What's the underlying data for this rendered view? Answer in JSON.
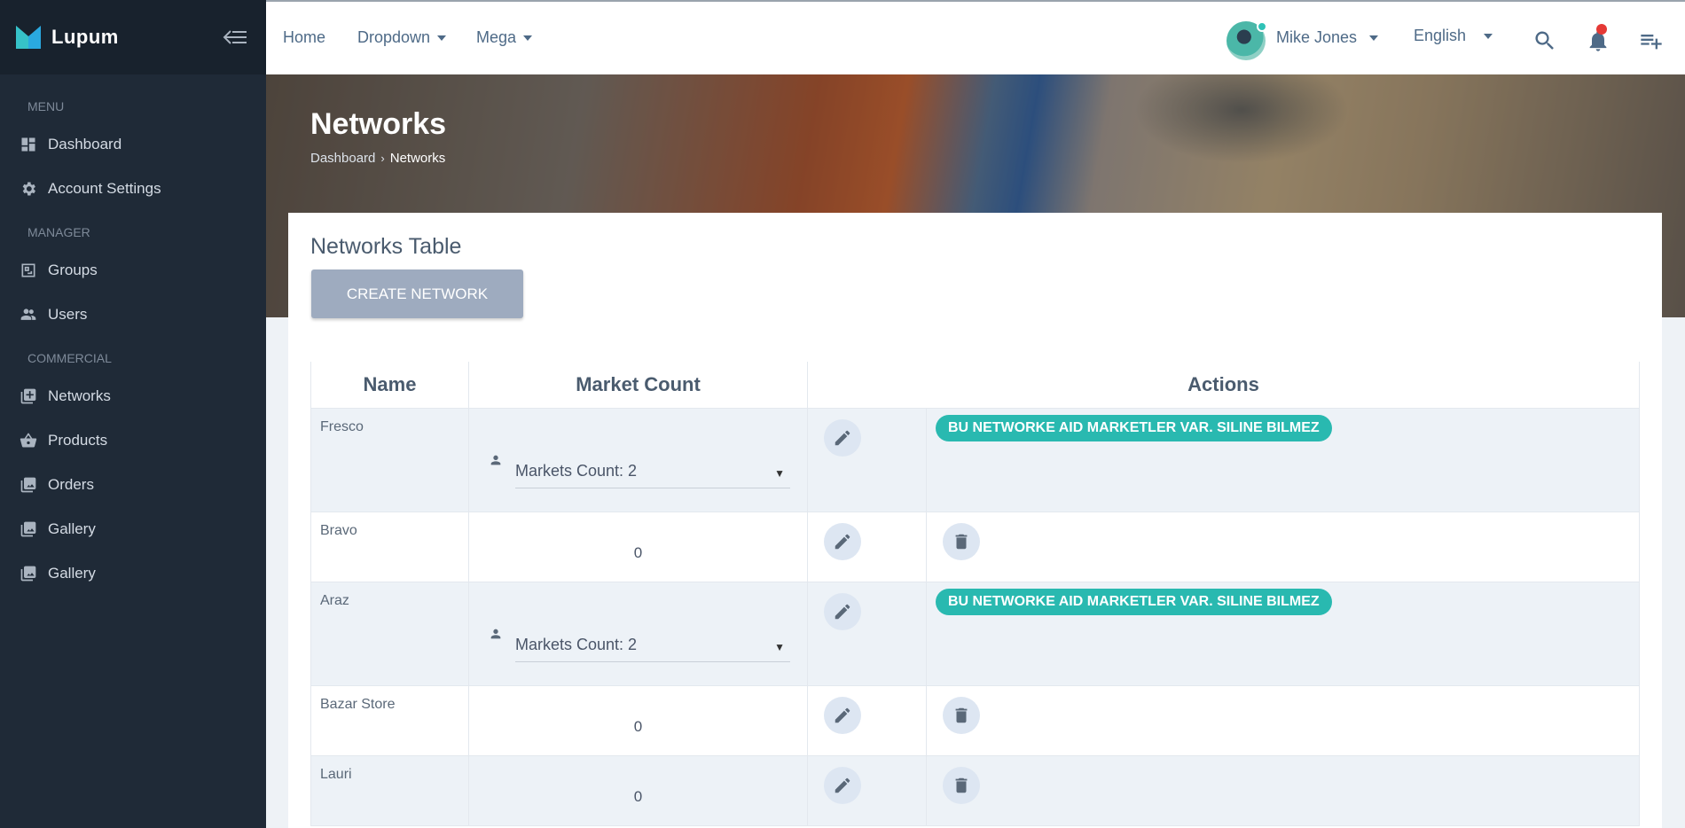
{
  "brand": {
    "name": "Lupum"
  },
  "sidebar": {
    "sections": [
      {
        "title": "MENU",
        "items": [
          {
            "label": "Dashboard",
            "icon": "dashboard-icon"
          },
          {
            "label": "Account Settings",
            "icon": "gear-icon"
          }
        ]
      },
      {
        "title": "MANAGER",
        "items": [
          {
            "label": "Groups",
            "icon": "groups-icon"
          },
          {
            "label": "Users",
            "icon": "users-icon"
          }
        ]
      },
      {
        "title": "COMMERCIAL",
        "items": [
          {
            "label": "Networks",
            "icon": "library-add-icon"
          },
          {
            "label": "Products",
            "icon": "basket-icon"
          },
          {
            "label": "Orders",
            "icon": "orders-icon"
          },
          {
            "label": "Gallery",
            "icon": "gallery-icon"
          },
          {
            "label": "Gallery",
            "icon": "gallery-icon"
          }
        ]
      }
    ]
  },
  "topbar": {
    "nav": [
      {
        "label": "Home"
      },
      {
        "label": "Dropdown"
      },
      {
        "label": "Mega"
      }
    ],
    "user_name": "Mike Jones",
    "language": "English"
  },
  "page": {
    "title": "Networks",
    "breadcrumb": [
      "Dashboard",
      "Networks"
    ]
  },
  "card": {
    "title": "Networks Table",
    "create_button": "CREATE NETWORK"
  },
  "table": {
    "headers": {
      "name": "Name",
      "count": "Market Count",
      "actions": "Actions"
    },
    "rows": [
      {
        "name": "Fresco",
        "count_select": "Markets Count: 2",
        "badge": "BU NETWORKE AID MARKETLER VAR. SILINE BILMEZ"
      },
      {
        "name": "Bravo",
        "count": "0"
      },
      {
        "name": "Araz",
        "count_select": "Markets Count: 2",
        "badge": "BU NETWORKE AID MARKETLER VAR. SILINE BILMEZ"
      },
      {
        "name": "Bazar Store",
        "count": "0"
      },
      {
        "name": "Lauri",
        "count": "0"
      }
    ]
  },
  "colors": {
    "sidebar": "#1f2a37",
    "accent": "#29b9b0",
    "button": "#9eabbf"
  }
}
